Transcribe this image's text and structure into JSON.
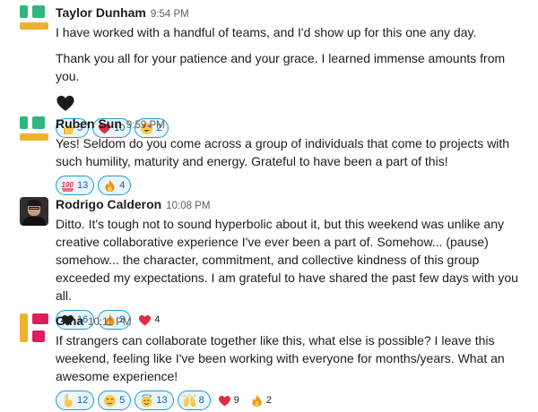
{
  "messages": [
    {
      "name": "Taylor Dunham",
      "time": "9:54 PM",
      "text1": "I have worked with a handful of teams, and I'd show up for this one any day.",
      "text2": "Thank you all for your patience and your grace. I learned immense amounts from you.",
      "reactions": [
        {
          "emoji": "thumbs-up",
          "count": "5"
        },
        {
          "emoji": "red-heart",
          "count": "10"
        },
        {
          "emoji": "heart-eyes",
          "count": "2"
        }
      ]
    },
    {
      "name": "Ruben Sun",
      "time": "9:59 PM",
      "text": "Yes! Seldom do you come across a group of individuals that come to projects with such humility, maturity and energy. Grateful to have been a part of this!",
      "reactions": [
        {
          "emoji": "hundred",
          "count": "13"
        },
        {
          "emoji": "fire",
          "count": "4"
        }
      ]
    },
    {
      "name": "Rodrigo Calderon",
      "time": "10:08 PM",
      "text": "Ditto. It's tough not to sound hyperbolic about it, but this weekend was unlike any creative collaborative experience I've ever been a part of. Somehow... (pause) somehow... the character, commitment, and collective kindness of this group exceeded my expectations. I am grateful to have shared the past few days with you all.",
      "reactions": [
        {
          "emoji": "black-heart",
          "count": "16"
        },
        {
          "emoji": "fire",
          "count": "3"
        },
        {
          "emoji": "red-heart",
          "count": "4"
        }
      ]
    },
    {
      "name": "Gina",
      "time": "10:11 PM",
      "text": "If strangers can collaborate together like this, what else is possible? I leave this weekend, feeling like I've been working with everyone for months/years. What an awesome experience!",
      "reactions": [
        {
          "emoji": "pointing-up",
          "count": "12"
        },
        {
          "emoji": "blush",
          "count": "5"
        },
        {
          "emoji": "halo",
          "count": "13"
        },
        {
          "emoji": "raised-hands",
          "count": "8"
        },
        {
          "emoji": "red-heart",
          "count": "9"
        },
        {
          "emoji": "fire",
          "count": "2"
        }
      ]
    }
  ],
  "colors": {
    "accent": "#1264a3",
    "green": "#2eb67d",
    "yellow": "#ecb22e",
    "pink": "#e01e5a"
  }
}
